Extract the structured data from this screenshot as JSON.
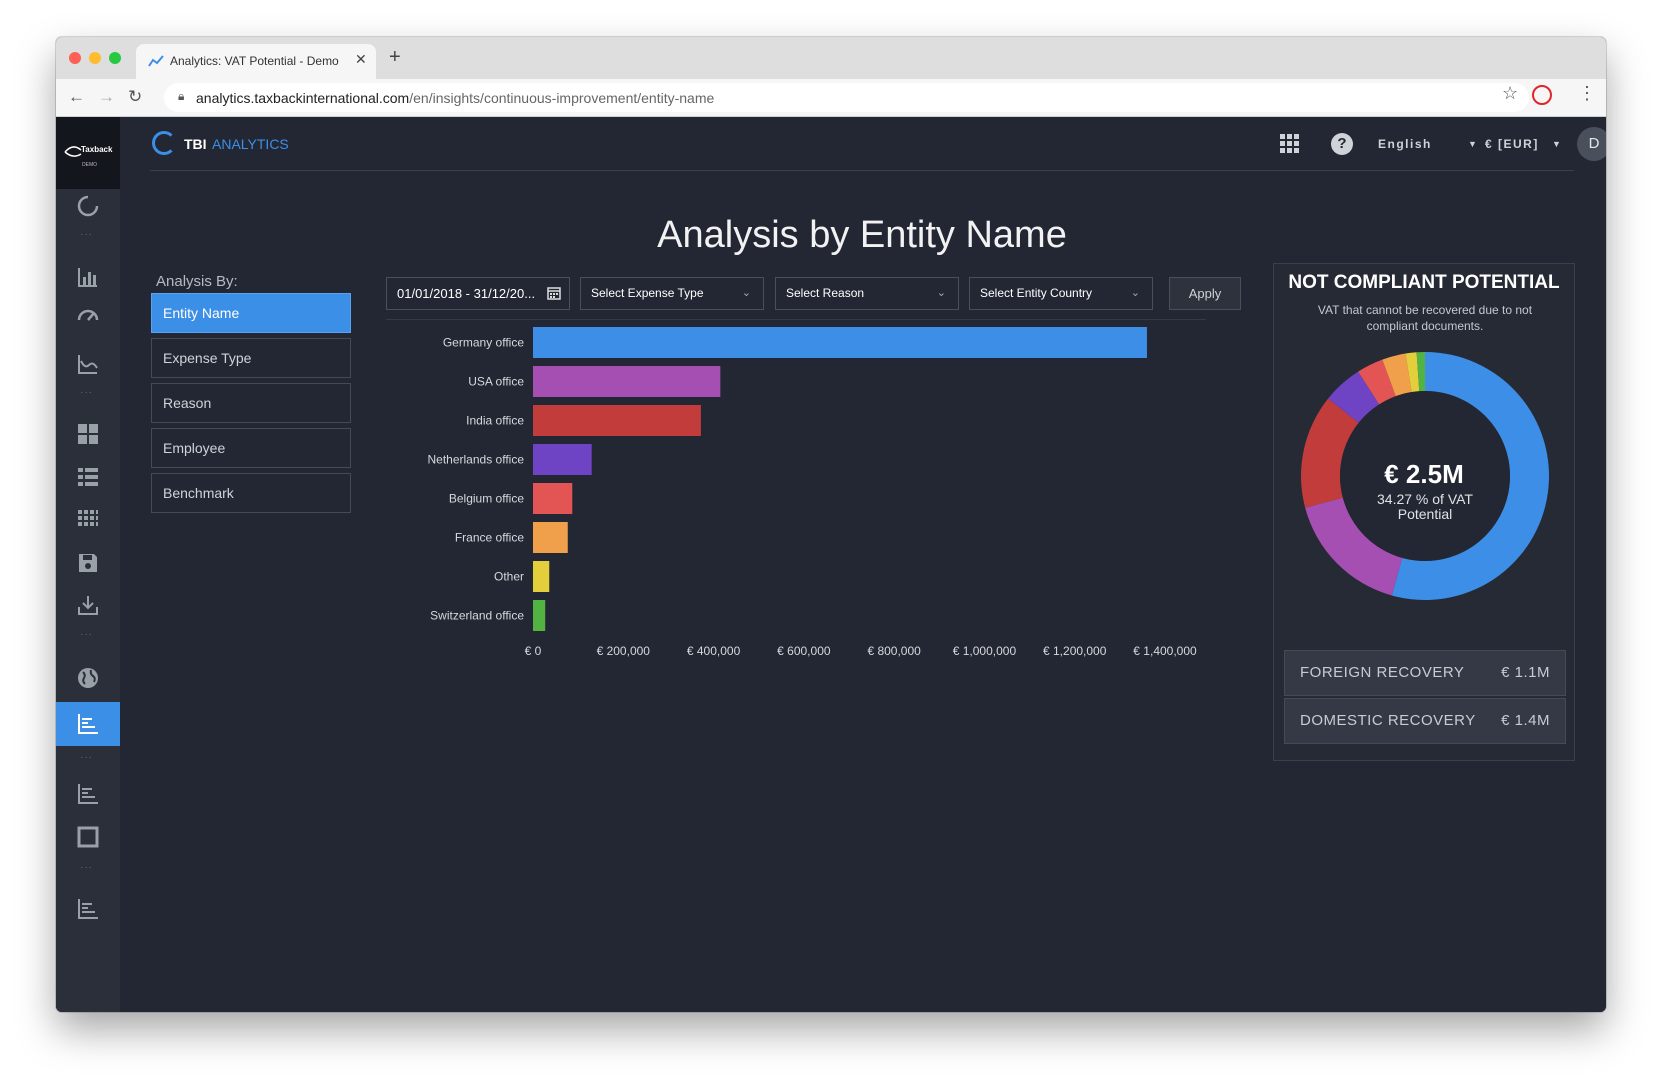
{
  "browser": {
    "tab_title": "Analytics: VAT Potential - Demo",
    "url_host": "analytics.taxbackinternational.com",
    "url_path": "/en/insights/continuous-improvement/entity-name"
  },
  "app": {
    "logo_text": "Taxback",
    "logo_sub": "DEMO",
    "brand_primary": "TBI",
    "brand_secondary": "ANALYTICS",
    "language": "English",
    "currency": "€ [EUR]",
    "avatar_initial": "D",
    "accent_color": "#3c8fe6"
  },
  "page": {
    "title": "Analysis by Entity Name",
    "analysis_by_label": "Analysis By:",
    "analysis_options": [
      "Entity Name",
      "Expense Type",
      "Reason",
      "Employee",
      "Benchmark"
    ],
    "active_option": "Entity Name"
  },
  "filters": {
    "date_range": "01/01/2018 - 31/12/20...",
    "expense_type": "Select Expense Type",
    "reason": "Select Reason",
    "entity_country": "Select Entity Country",
    "apply_label": "Apply"
  },
  "chart_data": {
    "type": "bar",
    "orientation": "horizontal",
    "categories": [
      "Germany office",
      "USA office",
      "India office",
      "Netherlands office",
      "Belgium office",
      "France office",
      "Other",
      "Switzerland office"
    ],
    "values": [
      1360000,
      415000,
      372000,
      130000,
      87000,
      77000,
      36000,
      27000
    ],
    "colors": [
      "#3d8ee6",
      "#a54fb3",
      "#c23c3c",
      "#6e43c4",
      "#e35454",
      "#f0a04b",
      "#e3cf3c",
      "#52b343"
    ],
    "x_ticks": [
      "€ 0",
      "€ 200,000",
      "€ 400,000",
      "€ 600,000",
      "€ 800,000",
      "€ 1,000,000",
      "€ 1,200,000",
      "€ 1,400,000"
    ],
    "xlim": [
      0,
      1400000
    ],
    "grid": false
  },
  "summary": {
    "title": "NOT COMPLIANT POTENTIAL",
    "subtitle": "VAT that cannot be recovered due to not compliant documents.",
    "total": "€ 2.5M",
    "percent_text": "34.27 % of VAT Potential",
    "donut_values": [
      1360000,
      415000,
      372000,
      130000,
      87000,
      77000,
      36000,
      27000
    ],
    "foreign_label": "FOREIGN RECOVERY",
    "foreign_value": "€ 1.1M",
    "domestic_label": "DOMESTIC RECOVERY",
    "domestic_value": "€ 1.4M"
  }
}
